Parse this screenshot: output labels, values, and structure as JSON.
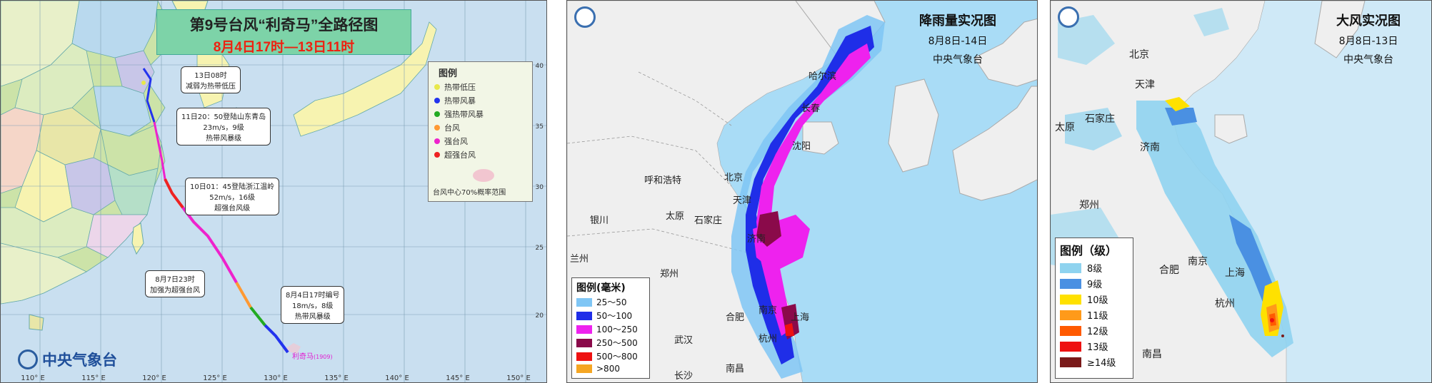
{
  "track_map": {
    "title_line1": "第9号台风“利奇马”全路径图",
    "title_line2": "8月4日17时—13日11时",
    "legend_title": "图例",
    "legend_items": [
      {
        "label": "热带低压",
        "color": "#e8e84a"
      },
      {
        "label": "热带风暴",
        "color": "#2233ee"
      },
      {
        "label": "强热带风暴",
        "color": "#22aa22"
      },
      {
        "label": "台风",
        "color": "#ff9933"
      },
      {
        "label": "强台风",
        "color": "#ee22cc"
      },
      {
        "label": "超强台风",
        "color": "#ee2222"
      }
    ],
    "prob_label": "台风中心70%概率范围",
    "annotations": [
      {
        "line1": "13日08时",
        "line2": "减弱为热带低压"
      },
      {
        "line1": "11日20：50登陆山东青岛",
        "line2": "23m/s，9级",
        "line3": "热带风暴级"
      },
      {
        "line1": "10日01：45登陆浙江温岭",
        "line2": "52m/s，16级",
        "line3": "超强台风级"
      },
      {
        "line1": "8月7日23时",
        "line2": "加强为超强台风"
      },
      {
        "line1": "8月4日17时编号",
        "line2": "18m/s，8级",
        "line3": "热带风暴级"
      }
    ],
    "storm_name": "利奇马",
    "storm_code": "(1909)",
    "agency": "中央气象台",
    "lon_labels": [
      "110° E",
      "115° E",
      "120° E",
      "125° E",
      "130° E",
      "135° E",
      "140° E",
      "145° E",
      "150° E"
    ],
    "lat_labels": [
      "20",
      "25",
      "30",
      "35",
      "40"
    ]
  },
  "rain_map": {
    "title": "降雨量实况图",
    "period": "8月8日-14日",
    "agency": "中央气象台",
    "legend_title": "图例(毫米)",
    "legend_items": [
      {
        "label": "25～50",
        "color": "#7fc6f5"
      },
      {
        "label": "50～100",
        "color": "#1f2ee8"
      },
      {
        "label": "100～250",
        "color": "#ee22ee"
      },
      {
        "label": "250～500",
        "color": "#8a0a4a"
      },
      {
        "label": "500～800",
        "color": "#ee1111"
      },
      {
        "label": ">800",
        "color": "#f5a623"
      }
    ],
    "cities": [
      "哈尔滨",
      "长春",
      "沈阳",
      "呼和浩特",
      "北京",
      "天津",
      "银川",
      "太原",
      "石家庄",
      "济南",
      "兰州",
      "郑州",
      "合肥",
      "南京",
      "上海",
      "武汉",
      "杭州",
      "南昌",
      "长沙"
    ]
  },
  "wind_map": {
    "title": "大风实况图",
    "period": "8月8日-13日",
    "agency": "中央气象台",
    "legend_title": "图例（级）",
    "legend_items": [
      {
        "label": "8级",
        "color": "#8fd3ef"
      },
      {
        "label": "9级",
        "color": "#4a90e2"
      },
      {
        "label": "10级",
        "color": "#ffe100"
      },
      {
        "label": "11级",
        "color": "#ff9a1a"
      },
      {
        "label": "12级",
        "color": "#ff5a00"
      },
      {
        "label": "13级",
        "color": "#ee1111"
      },
      {
        "label": "≥14级",
        "color": "#7a1a1a"
      }
    ],
    "cities": [
      "北京",
      "天津",
      "石家庄",
      "太原",
      "济南",
      "郑州",
      "南京",
      "合肥",
      "上海",
      "杭州",
      "南昌"
    ]
  }
}
